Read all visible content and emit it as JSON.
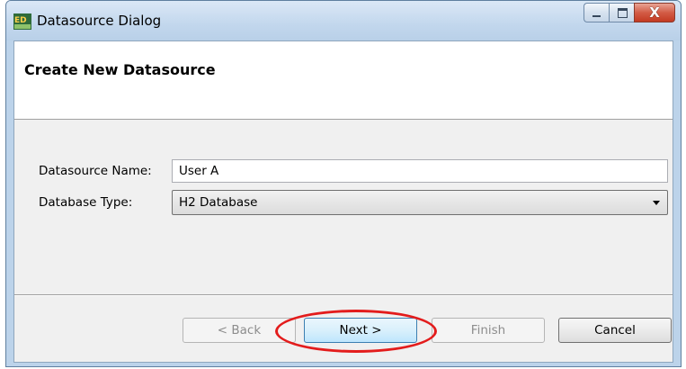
{
  "window": {
    "title": "Datasource Dialog",
    "icon": "app-icon",
    "close_glyph": "X"
  },
  "header": {
    "title": "Create New Datasource"
  },
  "form": {
    "name_label": "Datasource Name:",
    "name_value": "User A",
    "type_label": "Database Type:",
    "type_value": "H2 Database"
  },
  "buttons": {
    "back": "< Back",
    "next": "Next >",
    "finish": "Finish",
    "cancel": "Cancel"
  },
  "colors": {
    "highlight_ring": "#e31c1c",
    "titlebar": "#c2d7ed",
    "close_button": "#c33a22"
  }
}
